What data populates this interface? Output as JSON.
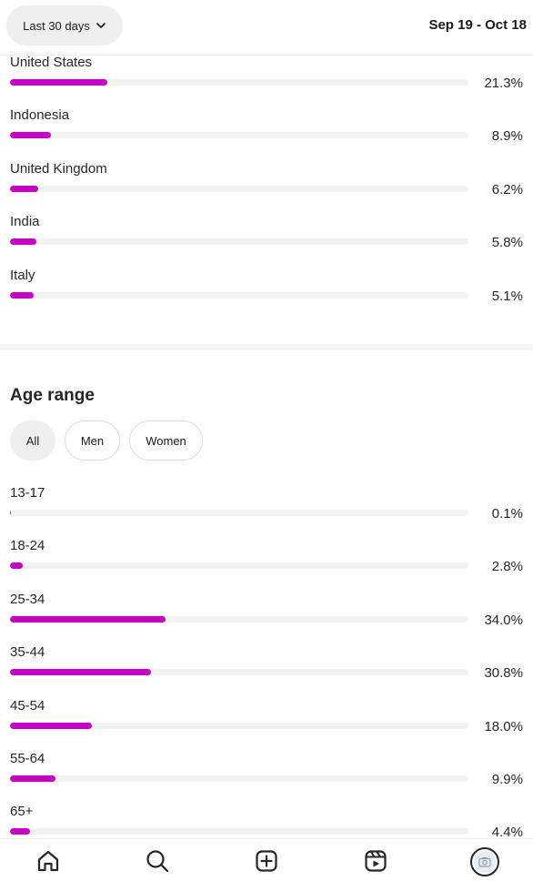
{
  "header": {
    "range_label": "Last 30 days",
    "date_range": "Sep 19 - Oct 18"
  },
  "countries": [
    {
      "label": "United States",
      "value": "21.3%",
      "pct": 21.3
    },
    {
      "label": "Indonesia",
      "value": "8.9%",
      "pct": 8.9
    },
    {
      "label": "United Kingdom",
      "value": "6.2%",
      "pct": 6.2
    },
    {
      "label": "India",
      "value": "5.8%",
      "pct": 5.8
    },
    {
      "label": "Italy",
      "value": "5.1%",
      "pct": 5.1
    }
  ],
  "age_section": {
    "title": "Age range",
    "filters": [
      {
        "label": "All",
        "active": true
      },
      {
        "label": "Men",
        "active": false
      },
      {
        "label": "Women",
        "active": false
      }
    ],
    "rows": [
      {
        "label": "13-17",
        "value": "0.1%",
        "pct": 0.1
      },
      {
        "label": "18-24",
        "value": "2.8%",
        "pct": 2.8
      },
      {
        "label": "25-34",
        "value": "34.0%",
        "pct": 34.0
      },
      {
        "label": "35-44",
        "value": "30.8%",
        "pct": 30.8
      },
      {
        "label": "45-54",
        "value": "18.0%",
        "pct": 18.0
      },
      {
        "label": "55-64",
        "value": "9.9%",
        "pct": 9.9
      },
      {
        "label": "65+",
        "value": "4.4%",
        "pct": 4.4
      }
    ]
  },
  "colors": {
    "bar_fill": "#c800c3",
    "bar_track": "#f2f2f2"
  },
  "nav": {
    "icons": [
      "home-icon",
      "search-icon",
      "create-icon",
      "reels-icon",
      "profile-avatar"
    ]
  }
}
